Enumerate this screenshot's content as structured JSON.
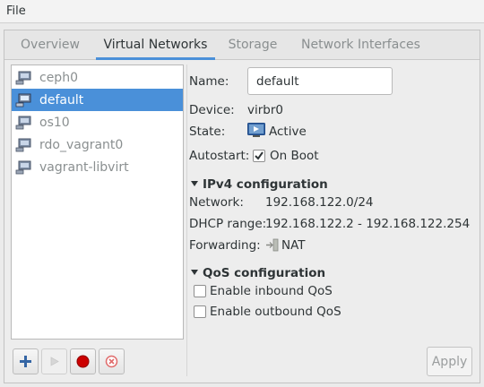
{
  "menubar": {
    "file": "File"
  },
  "tabs": [
    {
      "label": "Overview",
      "active": false
    },
    {
      "label": "Virtual Networks",
      "active": true
    },
    {
      "label": "Storage",
      "active": false
    },
    {
      "label": "Network Interfaces",
      "active": false
    }
  ],
  "networks": [
    {
      "name": "ceph0",
      "selected": false,
      "icon": "network-icon"
    },
    {
      "name": "default",
      "selected": true,
      "icon": "network-icon"
    },
    {
      "name": "os10",
      "selected": false,
      "icon": "network-icon"
    },
    {
      "name": "rdo_vagrant0",
      "selected": false,
      "icon": "network-icon"
    },
    {
      "name": "vagrant-libvirt",
      "selected": false,
      "icon": "network-icon"
    }
  ],
  "list_buttons": [
    {
      "name": "add-network-button",
      "icon": "plus-icon",
      "enabled": true
    },
    {
      "name": "start-network-button",
      "icon": "play-icon",
      "enabled": false
    },
    {
      "name": "stop-network-button",
      "icon": "stop-icon",
      "enabled": true
    },
    {
      "name": "delete-network-button",
      "icon": "delete-icon",
      "enabled": true
    }
  ],
  "details": {
    "name_label": "Name:",
    "name_value": "default",
    "device_label": "Device:",
    "device_value": "virbr0",
    "state_label": "State:",
    "state_value": "Active",
    "autostart_label": "Autostart:",
    "autostart_value": "On Boot",
    "autostart_checked": true
  },
  "ipv4": {
    "header": "IPv4 configuration",
    "network_label": "Network:",
    "network_value": "192.168.122.0/24",
    "dhcp_label": "DHCP range:",
    "dhcp_value": "192.168.122.2 - 192.168.122.254",
    "forwarding_label": "Forwarding:",
    "forwarding_value": "NAT"
  },
  "qos": {
    "header": "QoS configuration",
    "inbound_label": "Enable inbound QoS",
    "inbound_checked": false,
    "outbound_label": "Enable outbound QoS",
    "outbound_checked": false
  },
  "apply_label": "Apply",
  "colors": {
    "accent": "#4a90d9",
    "stop_red": "#cc0000",
    "add_blue": "#3465a4"
  }
}
